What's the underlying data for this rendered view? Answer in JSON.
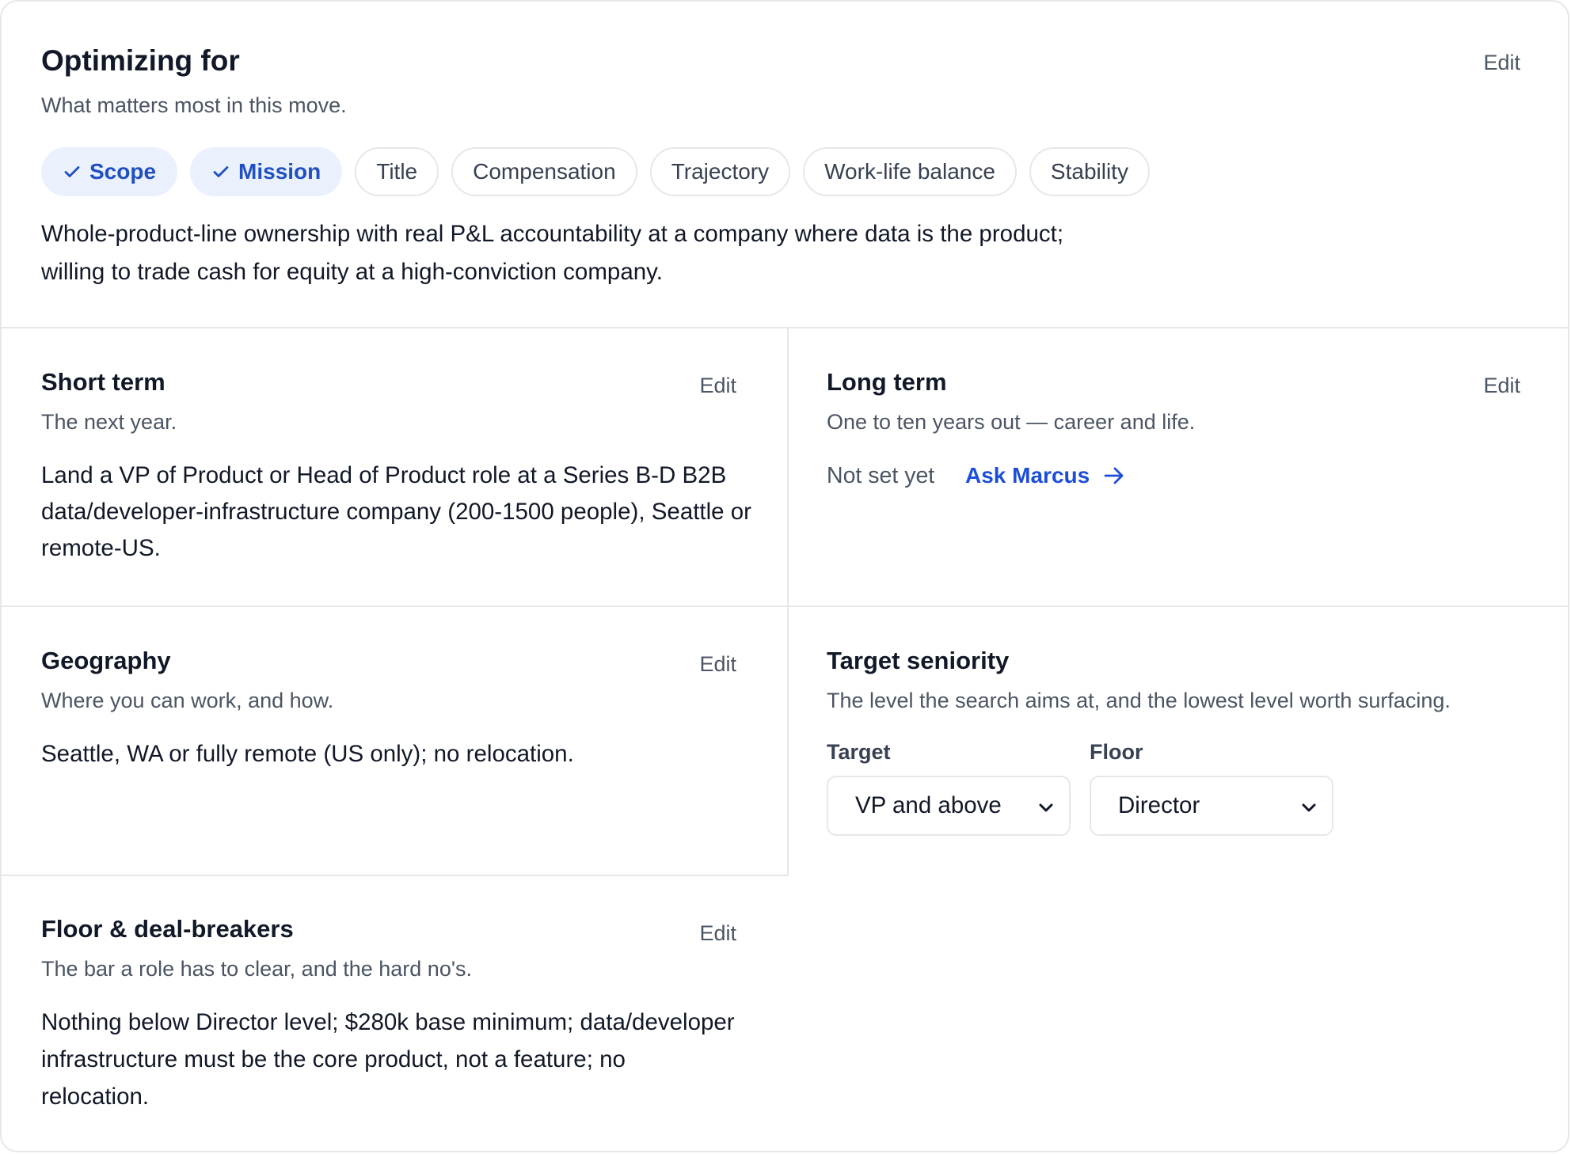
{
  "optimizing": {
    "title": "Optimizing for",
    "subtitle": "What matters most in this move.",
    "edit_label": "Edit",
    "chips": [
      {
        "label": "Scope",
        "selected": true
      },
      {
        "label": "Mission",
        "selected": true
      },
      {
        "label": "Title",
        "selected": false
      },
      {
        "label": "Compensation",
        "selected": false
      },
      {
        "label": "Trajectory",
        "selected": false
      },
      {
        "label": "Work-life balance",
        "selected": false
      },
      {
        "label": "Stability",
        "selected": false
      }
    ],
    "description": "Whole-product-line ownership with real P&L accountability at a company where data is the product; willing to trade cash for equity at a high-conviction company."
  },
  "short_term": {
    "title": "Short term",
    "subtitle": "The next year.",
    "edit_label": "Edit",
    "body": "Land a VP of Product or Head of Product role at a Series B-D B2B data/developer-infrastructure company (200-1500 people), Seattle or remote-US."
  },
  "long_term": {
    "title": "Long term",
    "subtitle": "One to ten years out — career and life.",
    "edit_label": "Edit",
    "empty_text": "Not set yet",
    "ask_link": "Ask Marcus"
  },
  "geography": {
    "title": "Geography",
    "subtitle": "Where you can work, and how.",
    "edit_label": "Edit",
    "body": "Seattle, WA or fully remote (US only); no relocation."
  },
  "seniority": {
    "title": "Target seniority",
    "subtitle": "The level the search aims at, and the lowest level worth surfacing.",
    "target_label": "Target",
    "target_value": "VP and above",
    "floor_label": "Floor",
    "floor_value": "Director"
  },
  "floor": {
    "title": "Floor & deal-breakers",
    "subtitle": "The bar a role has to clear, and the hard no's.",
    "edit_label": "Edit",
    "body": "Nothing below Director level; $280k base minimum; data/developer infrastructure must be the core product, not a feature; no relocation."
  },
  "colors": {
    "accent": "#1d4ed8",
    "chip_selected_bg": "#eaf1fd",
    "border": "#e5e7eb",
    "muted_text": "#4b5563"
  },
  "icons": {
    "chip_check": "check-icon",
    "link_arrow": "arrow-right-icon",
    "select_chevron": "chevron-down-icon"
  }
}
